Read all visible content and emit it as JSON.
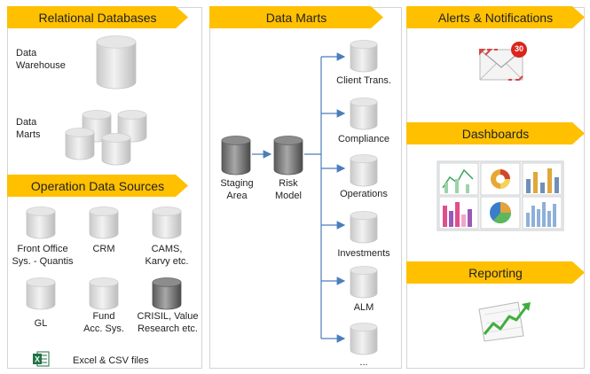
{
  "left": {
    "relational": {
      "title": "Relational Databases",
      "data_warehouse": [
        "Data",
        "Warehouse"
      ],
      "data_marts": [
        "Data",
        "Marts"
      ]
    },
    "operation": {
      "title": "Operation Data Sources",
      "sources": [
        [
          "Front Office",
          "Sys. - Quantis"
        ],
        [
          "CRM"
        ],
        [
          "CAMS,",
          "Karvy etc."
        ],
        [
          "GL"
        ],
        [
          "Fund",
          "Acc. Sys."
        ],
        [
          "CRISIL, Value",
          "Research etc."
        ]
      ],
      "excel_label": "Excel & CSV files"
    }
  },
  "middle": {
    "title": "Data Marts",
    "staging": [
      "Staging",
      "Area"
    ],
    "risk": [
      "Risk",
      "Model"
    ],
    "marts": [
      "Client Trans.",
      "Compliance",
      "Operations",
      "Investments",
      "ALM",
      "..."
    ]
  },
  "right": {
    "alerts": {
      "title": "Alerts & Notifications",
      "badge": "30"
    },
    "dashboards": {
      "title": "Dashboards"
    },
    "reporting": {
      "title": "Reporting"
    }
  },
  "colors": {
    "banner": "#ffc000",
    "connector": "#4a7ebb",
    "badge": "#d9261c",
    "excel": "#1f7244"
  }
}
